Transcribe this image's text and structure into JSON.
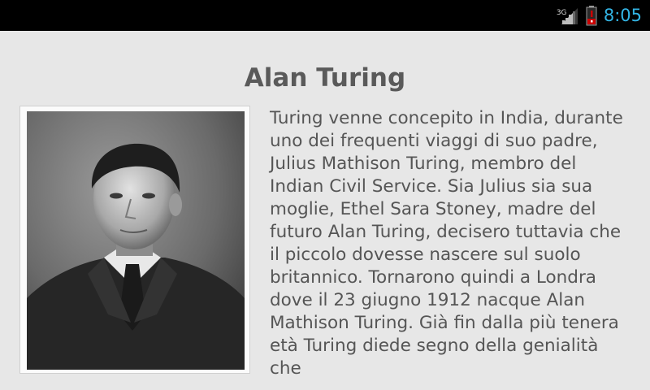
{
  "status_bar": {
    "network_type": "3G",
    "time": "8:05",
    "icons": [
      "signal-icon",
      "battery-alert-icon"
    ],
    "colors": {
      "background": "#000000",
      "clock": "#33b5e5",
      "battery_alert": "#cc0000"
    }
  },
  "article": {
    "title": "Alan Turing",
    "body": "Turing venne concepito in India, durante uno dei frequenti viaggi di suo padre, Julius Mathison Turing, membro del Indian Civil Service. Sia Julius sia sua moglie, Ethel Sara Stoney, madre del futuro Alan Turing, decisero tuttavia che il piccolo dovesse nascere sul suolo britannico. Tornarono quindi a Londra dove il 23 giugno 1912 nacque Alan Mathison Turing. Già fin dalla più tenera età Turing diede segno della genialità che"
  },
  "colors": {
    "page_background": "#e7e7e7",
    "text": "#555555",
    "title": "#5a5a5a"
  }
}
